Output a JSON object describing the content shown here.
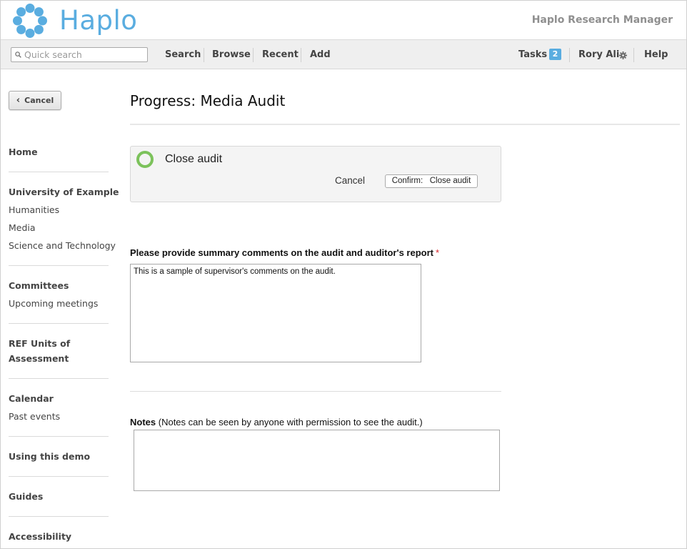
{
  "header": {
    "brand": "Haplo",
    "product": "Haplo Research Manager",
    "brand_color": "#5aade0"
  },
  "nav": {
    "search_placeholder": "Quick search",
    "search": "Search",
    "browse": "Browse",
    "recent": "Recent",
    "add": "Add",
    "tasks": "Tasks",
    "tasks_count": "2",
    "user": "Rory Ali",
    "help": "Help"
  },
  "sidebar": {
    "cancel": "Cancel",
    "home": "Home",
    "university": "University of Example",
    "humanities": "Humanities",
    "media": "Media",
    "science": "Science and Technology",
    "committees": "Committees",
    "upcoming": "Upcoming meetings",
    "ref_line1": "REF Units of",
    "ref_line2": "Assessment",
    "calendar": "Calendar",
    "past_events": "Past events",
    "using_demo": "Using this demo",
    "guides": "Guides",
    "accessibility": "Accessibility"
  },
  "main": {
    "title": "Progress: Media Audit",
    "transition_label": "Close audit",
    "transition_cancel": "Cancel",
    "confirm_button": "Confirm:   Close audit",
    "question_label": "Please provide summary comments on the audit and auditor's report",
    "required_marker": "*",
    "comments_value": "This is a sample of supervisor's comments on the audit.",
    "notes_label": "Notes",
    "notes_hint": "(Notes can be seen by anyone with permission to see the audit.)",
    "notes_value": ""
  }
}
